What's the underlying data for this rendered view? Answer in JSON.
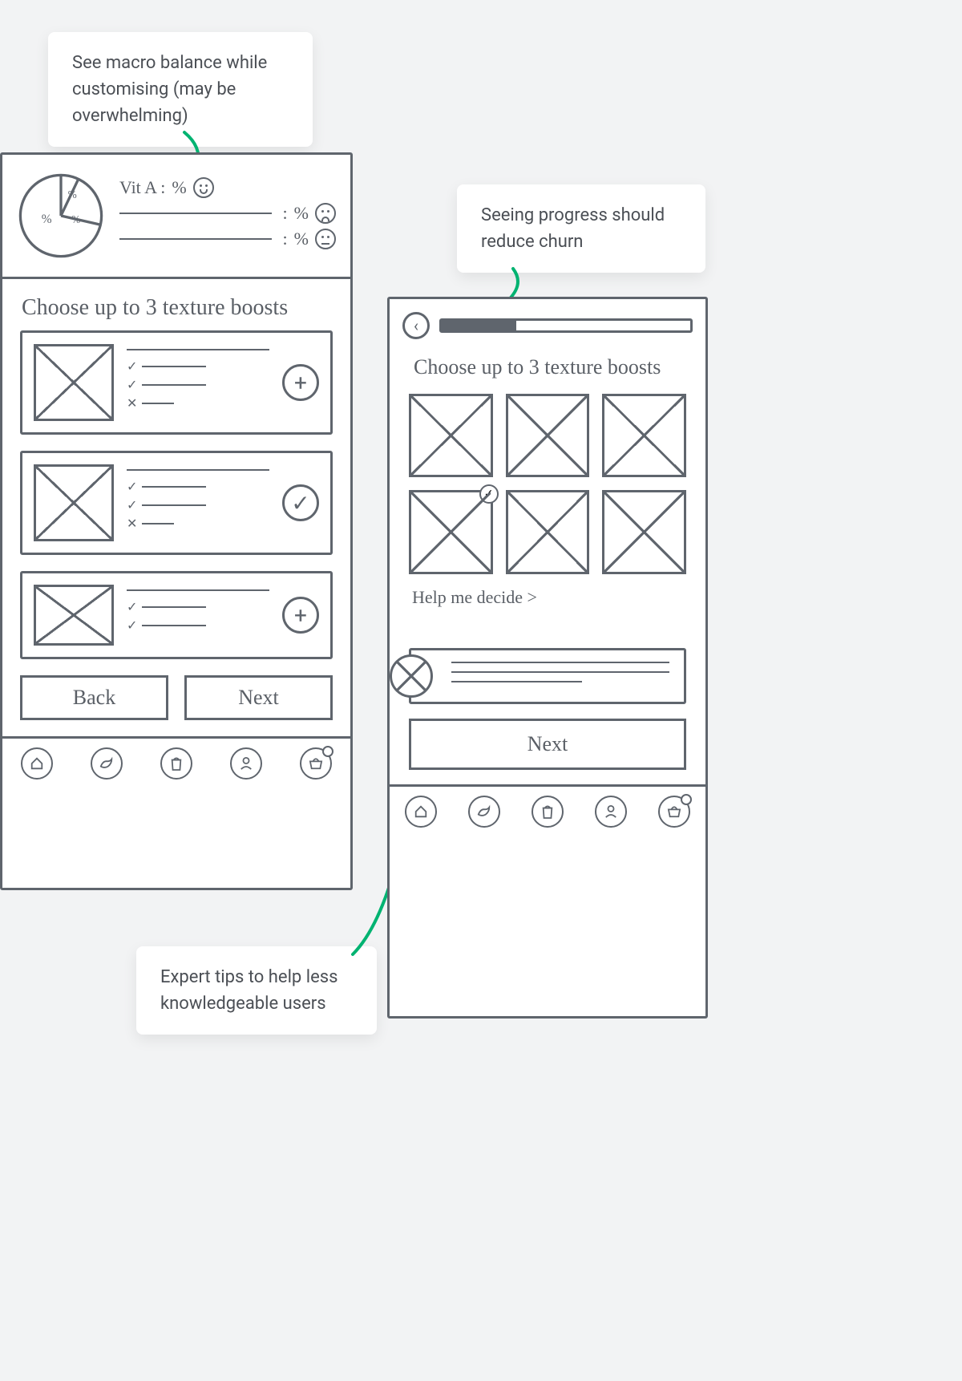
{
  "annotations": {
    "a1": "See macro balance while customising (may be overwhelming)",
    "a2": "Seeing progress should reduce churn",
    "a3": "Expert tips to help less knowledgeable users"
  },
  "left": {
    "macro": {
      "pie_slices": [
        "%",
        "%",
        "%"
      ],
      "row1_label": "Vit A :",
      "percent": "%",
      "faces": [
        "happy",
        "sad",
        "neutral"
      ]
    },
    "title": "Choose up to 3 texture boosts",
    "cards": [
      {
        "checks": [
          "✓",
          "✓",
          "✕"
        ],
        "cta": "plus"
      },
      {
        "checks": [
          "✓",
          "✓",
          "✕"
        ],
        "cta": "check"
      },
      {
        "checks": [
          "✓",
          "✓"
        ],
        "cta": "plus"
      }
    ],
    "back_label": "Back",
    "next_label": "Next",
    "nav": [
      "home",
      "bird",
      "food-bag",
      "profile",
      "basket"
    ]
  },
  "right": {
    "progress_pct": 30,
    "title": "Choose up to 3 texture boosts",
    "tiles_selected_index": 3,
    "help_link": "Help me decide >",
    "next_label": "Next",
    "nav": [
      "home",
      "bird",
      "food-bag",
      "profile",
      "basket"
    ]
  }
}
